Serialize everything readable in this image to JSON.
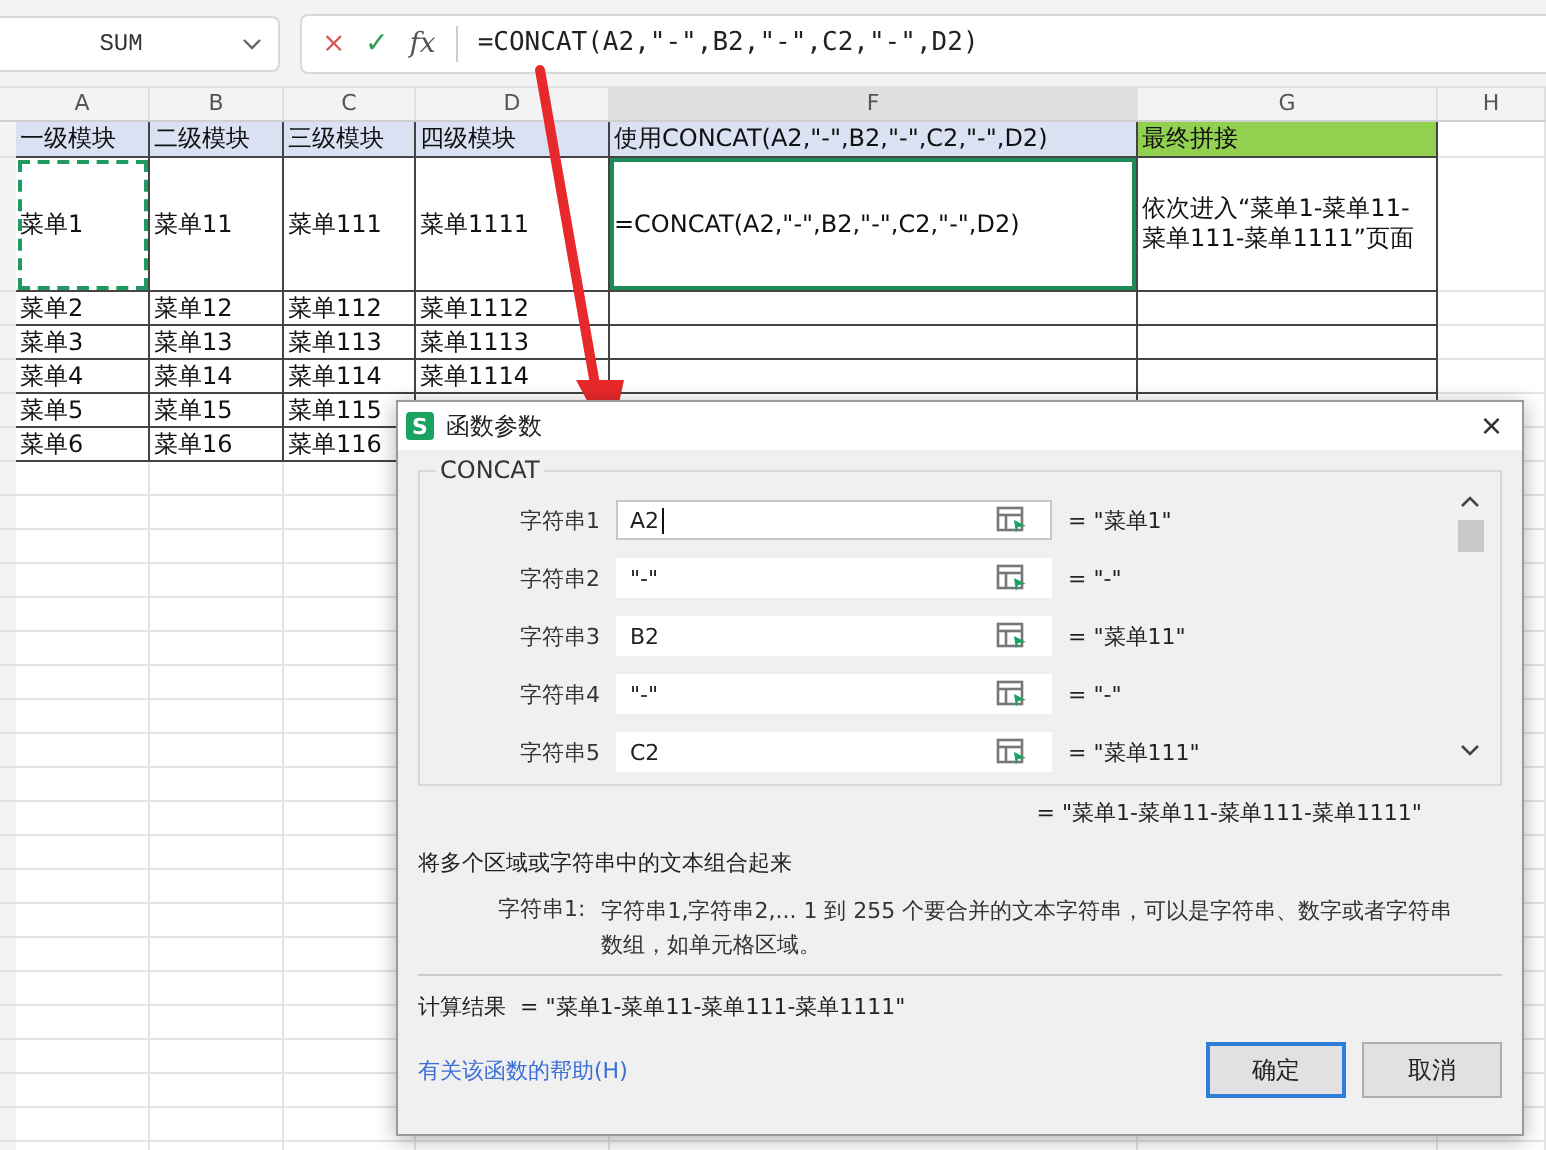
{
  "name_box": {
    "value": "SUM"
  },
  "formula_bar": {
    "cancel": "×",
    "confirm": "✓",
    "fx": "fx",
    "value": "=CONCAT(A2,\"-\",B2,\"-\",C2,\"-\",D2)"
  },
  "columns": [
    {
      "label": "A",
      "selected": false
    },
    {
      "label": "B",
      "selected": false
    },
    {
      "label": "C",
      "selected": false
    },
    {
      "label": "D",
      "selected": false
    },
    {
      "label": "F",
      "selected": true
    },
    {
      "label": "G",
      "selected": false
    },
    {
      "label": "H",
      "selected": false
    }
  ],
  "rows": [
    {
      "kind": "header",
      "cells": [
        {
          "text": "一级模块",
          "color": "#d9e1f2"
        },
        {
          "text": "二级模块",
          "color": "#d9e1f2"
        },
        {
          "text": "三级模块",
          "color": "#d9e1f2"
        },
        {
          "text": "四级模块",
          "color": "#d9e1f2"
        },
        {
          "text": "使用CONCAT(A2,\"-\",B2,\"-\",C2,\"-\",D2)",
          "color": "#d9e1f2"
        },
        {
          "text": "最终拼接",
          "color": "#92d050"
        }
      ]
    },
    {
      "kind": "tall",
      "cells": [
        {
          "text": "菜单1",
          "selected": false,
          "copied": true
        },
        {
          "text": "菜单11",
          "selected": false,
          "copied": false
        },
        {
          "text": "菜单111",
          "selected": false,
          "copied": false
        },
        {
          "text": "菜单1111",
          "selected": false,
          "copied": false
        },
        {
          "text": "=CONCAT(A2,\"-\",B2,\"-\",C2,\"-\",D2)",
          "selected": true,
          "copied": false
        },
        {
          "text": "依次进入“菜单1-菜单11-菜单111-菜单1111”页面",
          "selected": false,
          "copied": false
        }
      ]
    },
    {
      "kind": "data",
      "cells": [
        {
          "text": "菜单2",
          "selected": false,
          "copied": false
        },
        {
          "text": "菜单12",
          "selected": false,
          "copied": false
        },
        {
          "text": "菜单112",
          "selected": false,
          "copied": false
        },
        {
          "text": "菜单1112",
          "selected": false,
          "copied": false
        },
        {
          "selected": false,
          "copied": false
        },
        {
          "selected": false,
          "copied": false
        }
      ]
    },
    {
      "kind": "data",
      "cells": [
        {
          "text": "菜单3",
          "selected": false,
          "copied": false
        },
        {
          "text": "菜单13",
          "selected": false,
          "copied": false
        },
        {
          "text": "菜单113",
          "selected": false,
          "copied": false
        },
        {
          "text": "菜单1113",
          "selected": false,
          "copied": false
        },
        {
          "selected": false,
          "copied": false
        },
        {
          "selected": false,
          "copied": false
        }
      ]
    },
    {
      "kind": "data",
      "cells": [
        {
          "text": "菜单4",
          "selected": false,
          "copied": false
        },
        {
          "text": "菜单14",
          "selected": false,
          "copied": false
        },
        {
          "text": "菜单114",
          "selected": false,
          "copied": false
        },
        {
          "text": "菜单1114",
          "selected": false,
          "copied": false
        },
        {
          "selected": false,
          "copied": false
        },
        {
          "selected": false,
          "copied": false
        }
      ]
    },
    {
      "kind": "data",
      "cells": [
        {
          "text": "菜单5",
          "selected": false,
          "copied": false
        },
        {
          "text": "菜单15",
          "selected": false,
          "copied": false
        },
        {
          "text": "菜单115",
          "selected": false,
          "copied": false
        }
      ]
    },
    {
      "kind": "data",
      "cells": [
        {
          "text": "菜单6",
          "selected": false,
          "copied": false
        },
        {
          "text": "菜单16",
          "selected": false,
          "copied": false
        },
        {
          "text": "菜单116",
          "selected": false,
          "copied": false
        }
      ]
    }
  ],
  "dialog": {
    "logo": "S",
    "title": "函数参数",
    "close": "×",
    "function_name": "CONCAT",
    "arguments": [
      {
        "label": "字符串1",
        "value": "A2",
        "result": "= \"菜单1\"",
        "focused": true
      },
      {
        "label": "字符串2",
        "value": "\"-\"",
        "result": "= \"-\"",
        "focused": false
      },
      {
        "label": "字符串3",
        "value": "B2",
        "result": "= \"菜单11\"",
        "focused": false
      },
      {
        "label": "字符串4",
        "value": "\"-\"",
        "result": "= \"-\"",
        "focused": false
      },
      {
        "label": "字符串5",
        "value": "C2",
        "result": "= \"菜单111\"",
        "focused": false
      }
    ],
    "total": "= \"菜单1-菜单11-菜单111-菜单1111\"",
    "description": "将多个区域或字符串中的文本组合起来",
    "param_label": "字符串1:",
    "param_help": "字符串1,字符串2,... 1 到 255 个要合并的文本字符串，可以是字符串、数字或者字符串数组，如单元格区域。",
    "result_label": "计算结果",
    "result_value": "= \"菜单1-菜单11-菜单111-菜单1111\"",
    "help_link": "有关该函数的帮助(H)",
    "buttons": [
      {
        "label": "确定",
        "selected": true
      },
      {
        "label": "取消",
        "selected": false
      }
    ]
  }
}
